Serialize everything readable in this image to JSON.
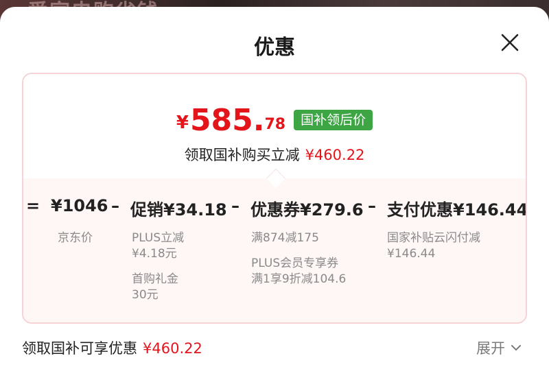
{
  "background": {
    "text": "爱家电购省钱"
  },
  "sheet": {
    "title": "优惠"
  },
  "price": {
    "symbol": "¥",
    "integer": "585.",
    "decimal": "78",
    "badge": "国补领后价"
  },
  "subsidy": {
    "label": "领取国补购买立减",
    "amount": "¥460.22"
  },
  "breakdown": {
    "items": [
      {
        "op": "=",
        "label": "¥1046",
        "notes": [
          "京东价"
        ]
      },
      {
        "op": "–",
        "label": "促销¥34.18",
        "notes": [
          "PLUS立减",
          "¥4.18元",
          "首购礼金",
          "30元"
        ]
      },
      {
        "op": "–",
        "label": "优惠券¥279.6",
        "notes": [
          "满874减175",
          "PLUS会员专享券",
          "满1享9折减104.6"
        ]
      },
      {
        "op": "–",
        "label": "支付优惠¥146.44",
        "notes": [
          "国家补贴云闪付减",
          "¥146.44"
        ]
      }
    ]
  },
  "footer": {
    "label": "领取国补可享优惠",
    "amount": "¥460.22",
    "expand": "展开"
  },
  "colors": {
    "accent_red": "#e4141b",
    "badge_green": "#3da544",
    "card_border": "#f6d3d6"
  }
}
